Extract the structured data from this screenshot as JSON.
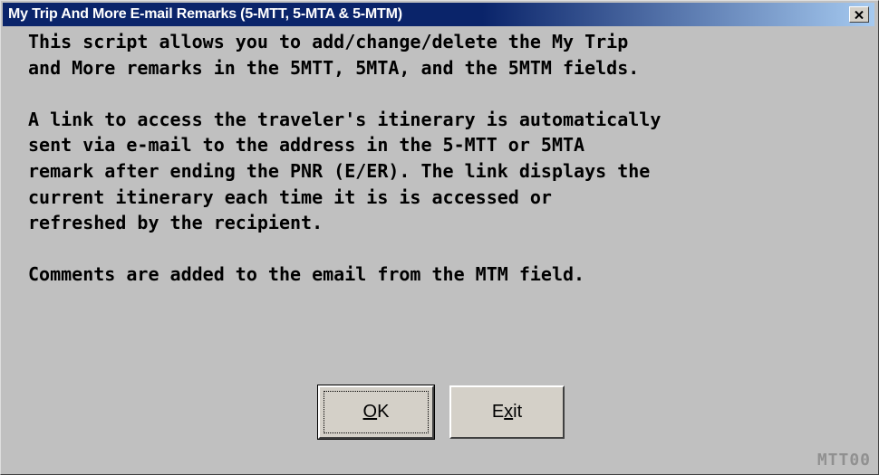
{
  "window": {
    "title": "My Trip And More E-mail Remarks (5-MTT, 5-MTA & 5-MTM)"
  },
  "message": {
    "lines": [
      "This script allows you to add/change/delete the My Trip",
      "and More remarks in the 5MTT, 5MTA, and the 5MTM fields.",
      "",
      "A link to access the traveler's itinerary is automatically",
      "sent via e-mail to the address in the 5-MTT or 5MTA",
      "remark after ending the PNR (E/ER). The link displays the",
      "current itinerary each time it is is accessed or",
      "refreshed by the recipient.",
      "",
      "Comments are added to the email from the MTM field."
    ]
  },
  "buttons": {
    "ok": {
      "mnemonic": "O",
      "rest": "K"
    },
    "exit": {
      "before": "E",
      "mnemonic": "x",
      "after": "it"
    }
  },
  "status": {
    "code": "MTT00"
  },
  "icons": {
    "close": "close-icon"
  }
}
